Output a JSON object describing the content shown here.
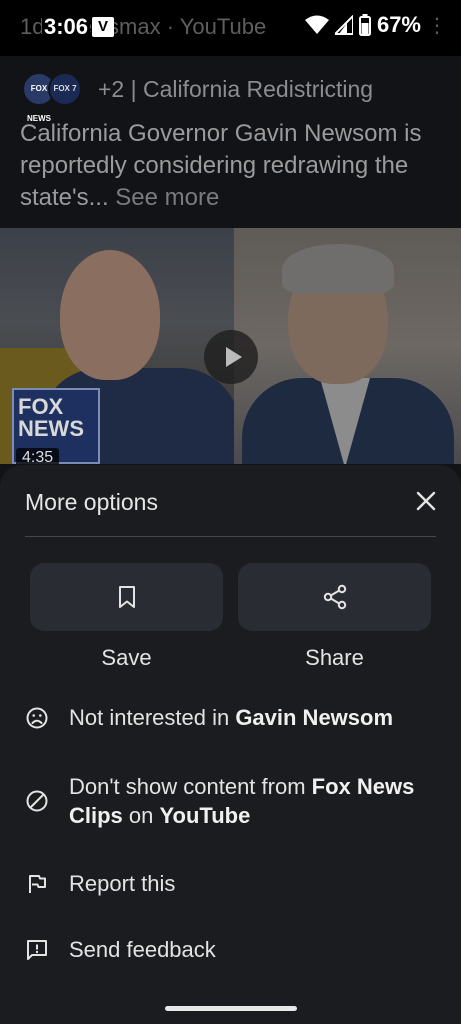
{
  "status_bar": {
    "time": "3:06",
    "behind_text": "1d · Newsmax · YouTube",
    "battery": "67%",
    "app_badge": "V"
  },
  "feed": {
    "source_logo_1": "FOX NEWS",
    "source_logo_2": "FOX 7",
    "source_line": "+2 | California Redistricting",
    "headline": "California Governor Gavin Newsom is reportedly considering redrawing the state's...",
    "see_more": "See more",
    "video": {
      "duration": "4:35",
      "badge": "FOX NEWS"
    }
  },
  "sheet": {
    "title": "More options",
    "actions": [
      {
        "label": "Save",
        "icon": "bookmark-icon"
      },
      {
        "label": "Share",
        "icon": "share-icon"
      }
    ],
    "menu": [
      {
        "icon": "sad-face-icon",
        "prefix": "Not interested in ",
        "bold1": "Gavin Newsom",
        "middle": "",
        "bold2": ""
      },
      {
        "icon": "block-icon",
        "prefix": "Don't show content from ",
        "bold1": "Fox News Clips",
        "middle": " on ",
        "bold2": "YouTube"
      },
      {
        "icon": "flag-icon",
        "prefix": "Report this",
        "bold1": "",
        "middle": "",
        "bold2": ""
      },
      {
        "icon": "feedback-icon",
        "prefix": "Send feedback",
        "bold1": "",
        "middle": "",
        "bold2": ""
      }
    ]
  },
  "colors": {
    "sheet_bg": "#1b1c20",
    "card_bg": "#2a2c33",
    "text": "#e3e3e3"
  }
}
